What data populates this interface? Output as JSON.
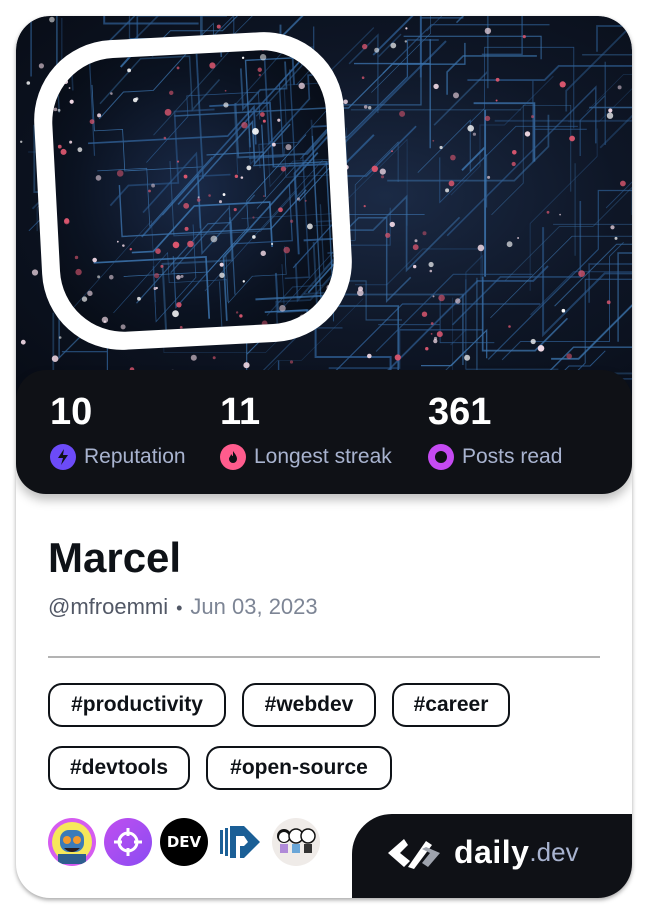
{
  "profile": {
    "name": "Marcel",
    "handle": "@mfroemmi",
    "separator": "•",
    "joined": "Jun 03, 2023"
  },
  "stats": [
    {
      "value": "10",
      "label": "Reputation",
      "icon": "lightning-icon",
      "color": "#6c4bf8"
    },
    {
      "value": "11",
      "label": "Longest streak",
      "icon": "flame-icon",
      "color": "#ff5c8d"
    },
    {
      "value": "361",
      "label": "Posts read",
      "icon": "eye-ring-icon",
      "color": "#c54af2"
    }
  ],
  "tags": [
    "#productivity",
    "#webdev",
    "#career",
    "#devtools",
    "#open-source"
  ],
  "sources": [
    {
      "name": "robot-avatar"
    },
    {
      "name": "crosshair-source"
    },
    {
      "name": "dev-to",
      "text": "DEV"
    },
    {
      "name": "p-logo-source"
    },
    {
      "name": "cartoon-people-source"
    }
  ],
  "brand": {
    "daily": "daily",
    "dev": ".dev"
  },
  "colors": {
    "dark_panel": "#0f1116",
    "label_gray": "#a8b3cf",
    "text_dark": "#0e1217"
  }
}
